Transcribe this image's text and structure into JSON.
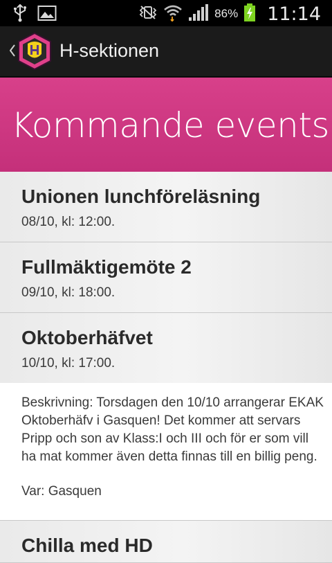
{
  "status_bar": {
    "battery": "86%",
    "time": "11:14"
  },
  "action_bar": {
    "title": "H-sektionen"
  },
  "banner": {
    "title": "Kommande events"
  },
  "events": [
    {
      "title": "Unionen lunchföreläsning",
      "date": "08/10, kl: 12:00."
    },
    {
      "title": "Fullmäktigemöte 2",
      "date": "09/10, kl: 18:00."
    },
    {
      "title": "Oktoberhäfvet",
      "date": "10/10, kl: 17:00.",
      "description": "Beskrivning: Torsdagen den 10/10 arrangerar EKAK Oktoberhäfv i Gasquen! Det kommer att servars Pripp och son av Klass:I och III och för er som vill ha mat kommer även detta finnas till en billig peng.",
      "location": "Var: Gasquen"
    },
    {
      "title": "Chilla med HD"
    }
  ],
  "colors": {
    "banner": "#d13a84",
    "action_bar": "#1b1b1b",
    "logo_accent": "#e0408a"
  }
}
